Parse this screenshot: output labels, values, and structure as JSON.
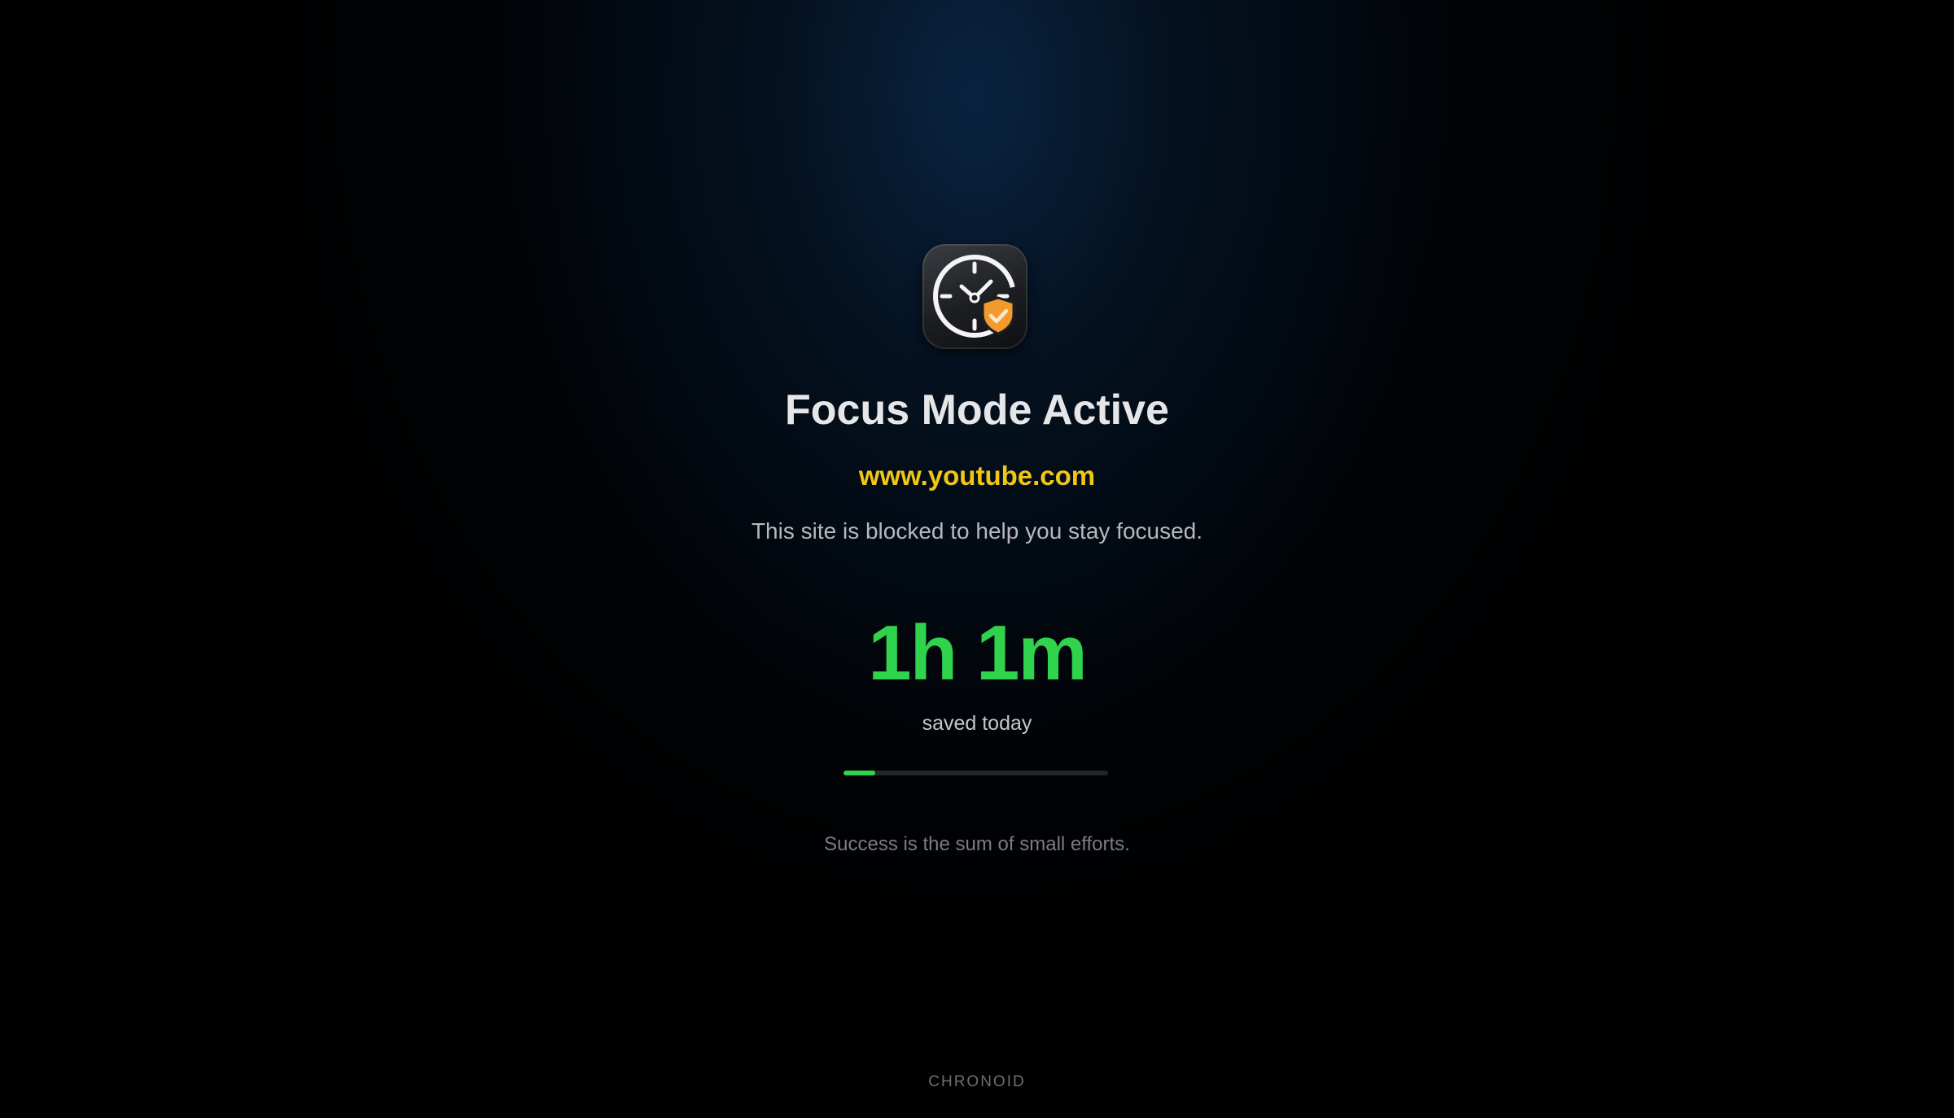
{
  "app": {
    "icon": "clock-shield-check-icon",
    "brand": "CHRONOID"
  },
  "block": {
    "title": "Focus Mode Active",
    "site": "www.youtube.com",
    "message": "This site is blocked to help you stay focused."
  },
  "stats": {
    "time_saved": "1h 1m",
    "time_saved_label": "saved today",
    "progress_percent": 12
  },
  "quote": "Success is the sum of small efforts.",
  "colors": {
    "accent_green": "#2fd34c",
    "site_yellow": "#f2c614",
    "shield_orange": "#f39a2e",
    "background": "#000000"
  }
}
